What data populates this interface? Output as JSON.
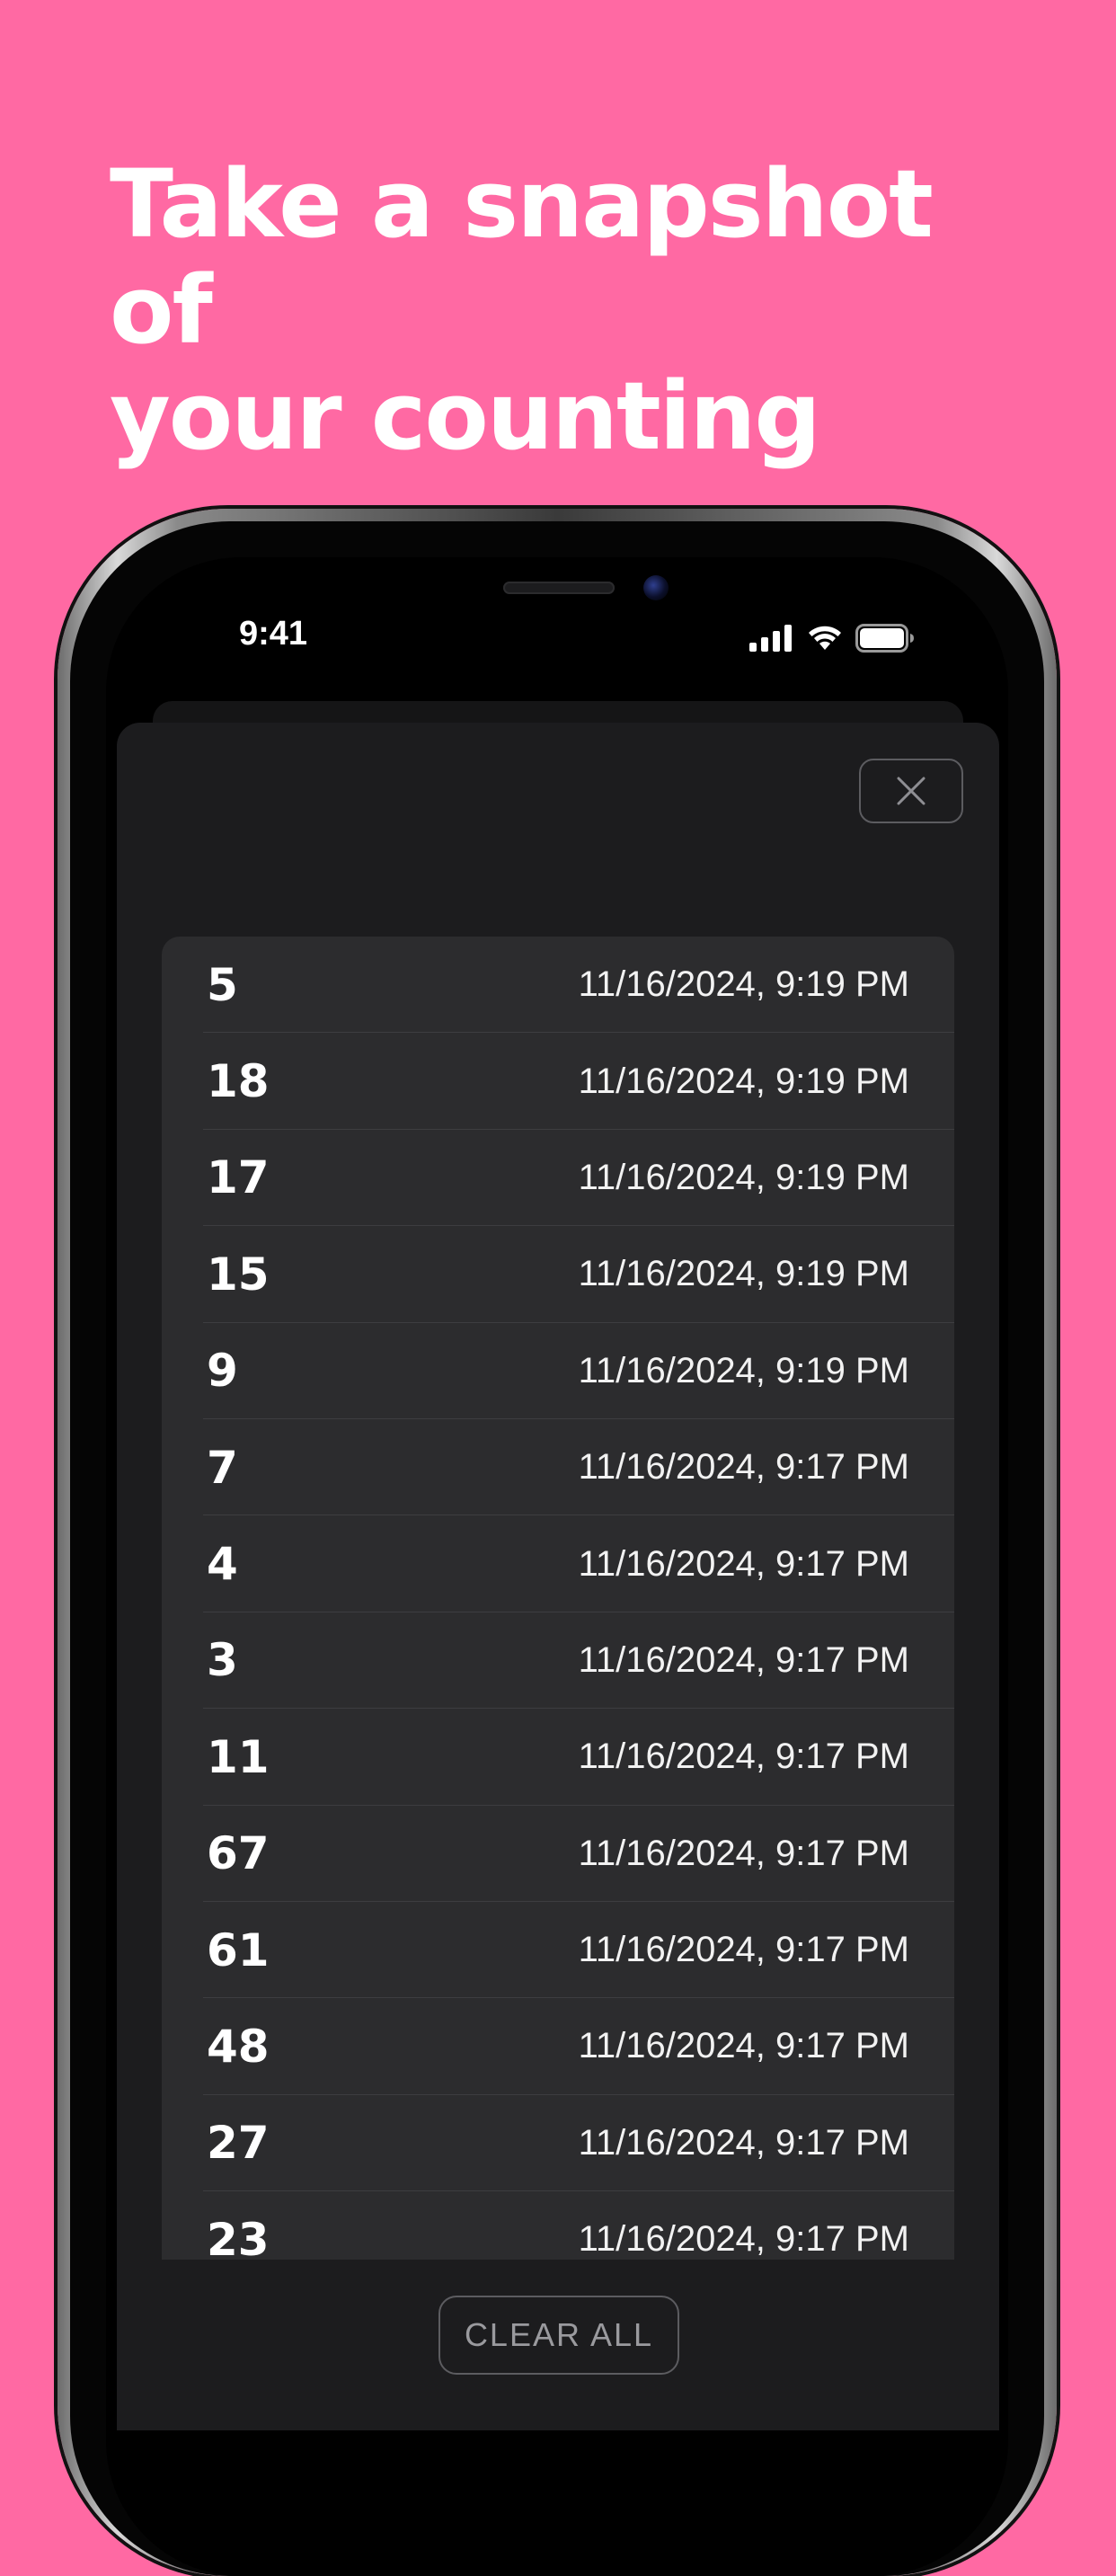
{
  "headline": {
    "line1": "Take a snapshot of",
    "line2": "your counting"
  },
  "status_bar": {
    "time": "9:41",
    "icons": [
      "cellular-signal-icon",
      "wifi-icon",
      "battery-icon"
    ]
  },
  "sheet": {
    "close_icon": "close-icon",
    "clear_all_label": "CLEAR ALL"
  },
  "history": [
    {
      "count": "5",
      "date": "11/16/2024, 9:19 PM"
    },
    {
      "count": "18",
      "date": "11/16/2024, 9:19 PM"
    },
    {
      "count": "17",
      "date": "11/16/2024, 9:19 PM"
    },
    {
      "count": "15",
      "date": "11/16/2024, 9:19 PM"
    },
    {
      "count": "9",
      "date": "11/16/2024, 9:19 PM"
    },
    {
      "count": "7",
      "date": "11/16/2024, 9:17 PM"
    },
    {
      "count": "4",
      "date": "11/16/2024, 9:17 PM"
    },
    {
      "count": "3",
      "date": "11/16/2024, 9:17 PM"
    },
    {
      "count": "11",
      "date": "11/16/2024, 9:17 PM"
    },
    {
      "count": "67",
      "date": "11/16/2024, 9:17 PM"
    },
    {
      "count": "61",
      "date": "11/16/2024, 9:17 PM"
    },
    {
      "count": "48",
      "date": "11/16/2024, 9:17 PM"
    },
    {
      "count": "27",
      "date": "11/16/2024, 9:17 PM"
    },
    {
      "count": "23",
      "date": "11/16/2024, 9:17 PM"
    }
  ],
  "colors": {
    "background": "#ff69a3",
    "sheet": "#1c1c1e",
    "list": "#2c2c2e",
    "text": "#ffffff"
  }
}
